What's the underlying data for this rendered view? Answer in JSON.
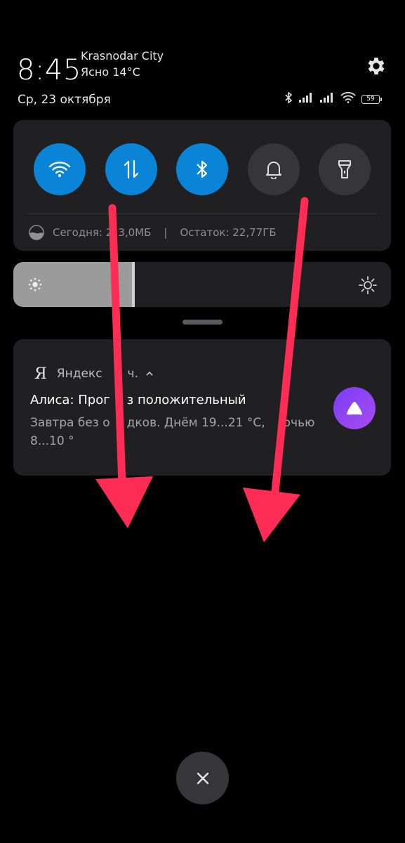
{
  "header": {
    "time": "8:45",
    "city": "Krasnodar City",
    "weather": "Ясно 14°C",
    "date": "Ср, 23 октября"
  },
  "status_bar": {
    "battery": "59",
    "icons": [
      "bluetooth-icon",
      "signal-icon",
      "signal-icon",
      "wifi-icon",
      "battery-icon"
    ]
  },
  "quick_settings": {
    "tiles": [
      {
        "name": "wifi",
        "icon": "wifi-icon",
        "state": "on"
      },
      {
        "name": "mobile-data",
        "icon": "data-transfer-icon",
        "state": "on"
      },
      {
        "name": "bluetooth",
        "icon": "bluetooth-icon",
        "state": "on"
      },
      {
        "name": "sound",
        "icon": "bell-icon",
        "state": "off"
      },
      {
        "name": "flashlight",
        "icon": "flashlight-icon",
        "state": "off"
      }
    ],
    "usage_today": "Сегодня: 2",
    "usage_today_suffix": "3,0МБ",
    "separator": "|",
    "remaining": "Остаток: 22,77ГБ"
  },
  "brightness": {
    "level_percent": 32
  },
  "notification": {
    "app_glyph": "Я",
    "app_name": "Яндекс",
    "app_time": "ч.",
    "title_part1": "Алиса: Прог",
    "title_part2": "з положительный",
    "body_line1a": "Завтра без о",
    "body_line1b": "дков. Днём 19...21 °С,",
    "body_line1c": "очью",
    "body_line2": "8...10 °"
  },
  "colors": {
    "accent": "#0a84d6",
    "arrow": "#ff2d55",
    "alice": "#8a3ff2"
  }
}
